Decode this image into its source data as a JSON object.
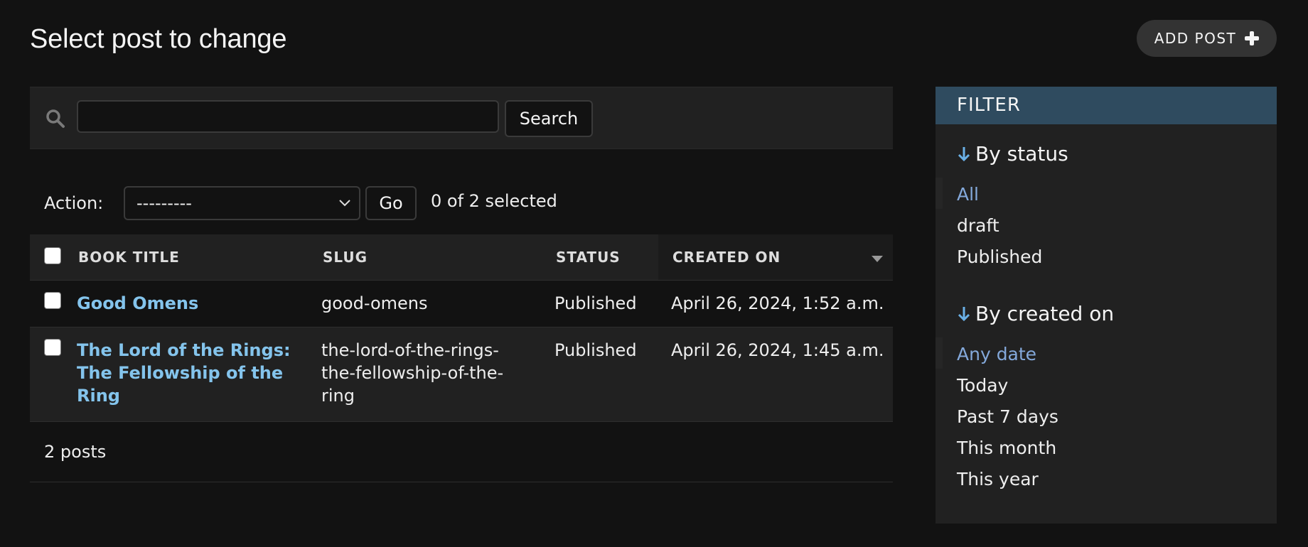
{
  "header": {
    "title": "Select post to change",
    "add_button": "ADD POST"
  },
  "search": {
    "value": "",
    "placeholder": "",
    "button": "Search"
  },
  "actions": {
    "label": "Action:",
    "selected_option": "---------",
    "go_button": "Go",
    "selection_count": "0 of 2 selected"
  },
  "table": {
    "columns": [
      "BOOK TITLE",
      "SLUG",
      "STATUS",
      "CREATED ON"
    ],
    "sorted_column": "CREATED ON",
    "rows": [
      {
        "title": "Good Omens",
        "slug": "good-omens",
        "status": "Published",
        "created_on": "April 26, 2024, 1:52 a.m."
      },
      {
        "title_lines": [
          "The Lord of the Rings:",
          "The Fellowship of the",
          "Ring"
        ],
        "slug_lines": [
          "the-lord-of-the-rings-",
          "the-fellowship-of-the-",
          "ring"
        ],
        "status": "Published",
        "created_on": "April 26, 2024, 1:45 a.m."
      }
    ]
  },
  "paginator": {
    "text": "2 posts"
  },
  "filter": {
    "title": "FILTER",
    "groups": [
      {
        "heading": "By status",
        "items": [
          "All",
          "draft",
          "Published"
        ],
        "selected": "All"
      },
      {
        "heading": "By created on",
        "items": [
          "Any date",
          "Today",
          "Past 7 days",
          "This month",
          "This year"
        ],
        "selected": "Any date"
      }
    ]
  },
  "colors": {
    "background": "#121212",
    "panel": "#212121",
    "link": "#84c4ec",
    "filter_header": "#2f4b5f",
    "filter_selected": "#84a9db"
  },
  "icons": {
    "search": "search-icon",
    "add": "plus-icon",
    "select": "chevron-down-icon",
    "sort": "sort-descending-icon",
    "filter_heading": "arrow-down-icon"
  }
}
